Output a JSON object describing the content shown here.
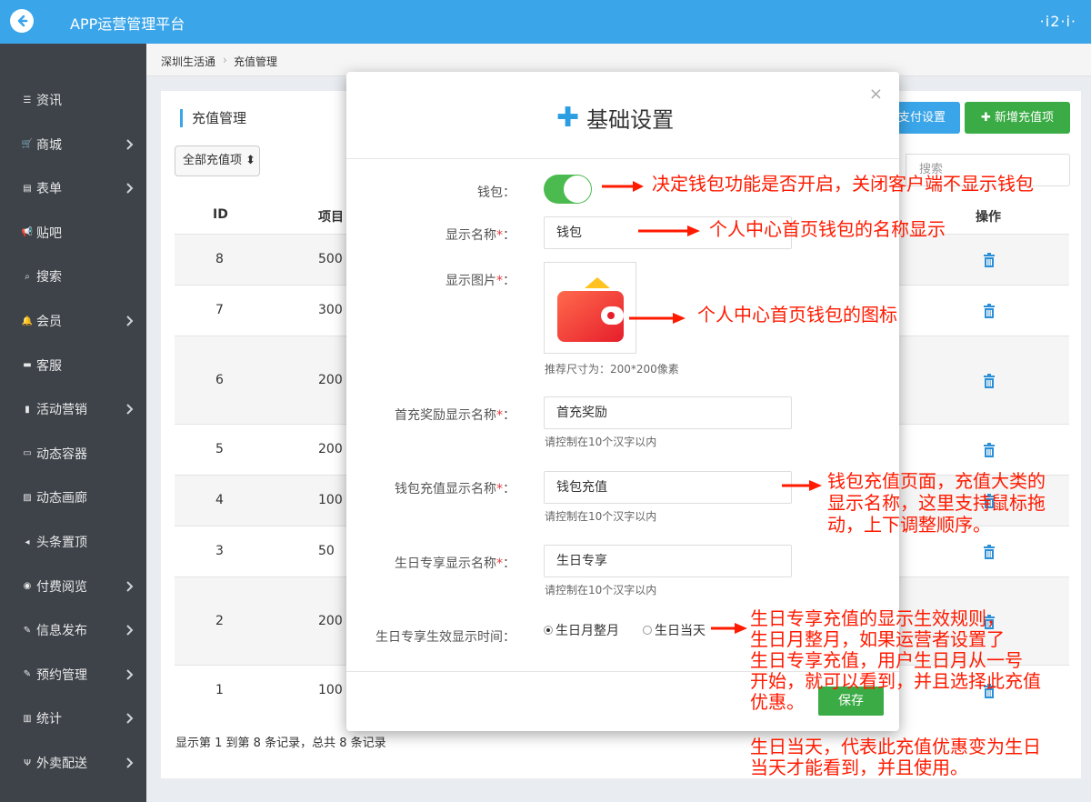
{
  "app": {
    "title": "APP运营管理平台",
    "user_menu": "·i2·i·"
  },
  "sidebar": {
    "items": [
      {
        "label": "资讯",
        "icon": "list-icon",
        "has_children": false
      },
      {
        "label": "商城",
        "icon": "cart-icon",
        "has_children": true
      },
      {
        "label": "表单",
        "icon": "form-icon",
        "has_children": true
      },
      {
        "label": "贴吧",
        "icon": "megaphone-icon",
        "has_children": false
      },
      {
        "label": "搜索",
        "icon": "search-icon",
        "has_children": false
      },
      {
        "label": "会员",
        "icon": "bell-icon",
        "has_children": true
      },
      {
        "label": "客服",
        "icon": "chat-icon",
        "has_children": false
      },
      {
        "label": "活动营销",
        "icon": "bookmark-icon",
        "has_children": true
      },
      {
        "label": "动态容器",
        "icon": "inbox-icon",
        "has_children": false
      },
      {
        "label": "动态画廊",
        "icon": "image-icon",
        "has_children": false
      },
      {
        "label": "头条置顶",
        "icon": "volume-icon",
        "has_children": false
      },
      {
        "label": "付费阅览",
        "icon": "play-circle-icon",
        "has_children": true
      },
      {
        "label": "信息发布",
        "icon": "edit-check-icon",
        "has_children": true
      },
      {
        "label": "预约管理",
        "icon": "edit-check-icon",
        "has_children": true
      },
      {
        "label": "统计",
        "icon": "bar-chart-icon",
        "has_children": true
      },
      {
        "label": "外卖配送",
        "icon": "cutlery-icon",
        "has_children": true
      }
    ]
  },
  "breadcrumb": {
    "root": "深圳生活通",
    "current": "充值管理"
  },
  "page": {
    "title": "充值管理",
    "filter_select": "全部充值项",
    "pay_settings_button": "支付设置",
    "add_button": "新增充值项",
    "search_placeholder": "搜索",
    "columns": {
      "id": "ID",
      "name": "项目",
      "actions": "操作"
    },
    "rows": [
      {
        "id": "8",
        "name": "500"
      },
      {
        "id": "7",
        "name": "300"
      },
      {
        "id": "6",
        "name": "200"
      },
      {
        "id": "5",
        "name": "200"
      },
      {
        "id": "4",
        "name": "100"
      },
      {
        "id": "3",
        "name": "50"
      },
      {
        "id": "2",
        "name": "200"
      },
      {
        "id": "1",
        "name": "100"
      }
    ],
    "footer_info": "显示第 1 到第 8 条记录，总共 8 条记录"
  },
  "modal": {
    "title": "基础设置",
    "close": "×",
    "wallet_label": "钱包：",
    "wallet_enabled": true,
    "display_name_label": "显示名称",
    "display_name_value": "钱包",
    "display_image_label": "显示图片",
    "image_hint": "推荐尺寸为：200*200像素",
    "first_recharge_label": "首充奖励显示名称",
    "first_recharge_value": "首充奖励",
    "first_recharge_help": "请控制在10个汉字以内",
    "wallet_recharge_label": "钱包充值显示名称",
    "wallet_recharge_value": "钱包充值",
    "wallet_recharge_help": "请控制在10个汉字以内",
    "birthday_label": "生日专享显示名称",
    "birthday_value": "生日专享",
    "birthday_help": "请控制在10个汉字以内",
    "birthday_time_label": "生日专享生效显示时间：",
    "birthday_option_month": "生日月整月",
    "birthday_option_day": "生日当天",
    "birthday_selected": "month",
    "required_mark": "*",
    "colon": "：",
    "save_button": "保存"
  },
  "annotations": {
    "a1": "决定钱包功能是否开启，关闭客户端不显示钱包",
    "a2": "个人中心首页钱包的名称显示",
    "a3": "个人中心首页钱包的图标",
    "a4": [
      "钱包充值页面，充值大类的",
      "显示名称，这里支持鼠标拖",
      "动，上下调整顺序。"
    ],
    "a5": [
      "生日专享充值的显示生效规则，",
      "生日月整月，如果运营者设置了",
      "生日专享充值，用户生日月从一号",
      "开始，就可以看到，并且选择此充值",
      "优惠。"
    ],
    "a6": [
      "生日当天，代表此充值优惠变为生日",
      "当天才能看到，并且使用。"
    ]
  },
  "colors": {
    "topbar": "#3aa5e9",
    "sidebar": "#3e434a",
    "success": "#3bab45",
    "annotation": "#ff1a00"
  }
}
